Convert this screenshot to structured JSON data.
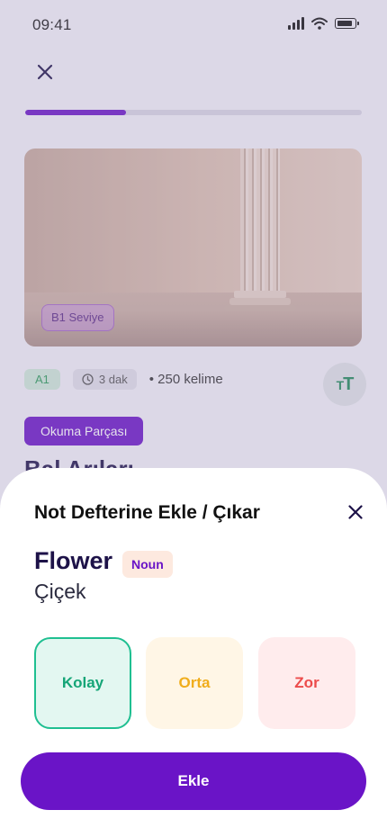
{
  "status": {
    "time": "09:41"
  },
  "lesson": {
    "progress_fraction": 0.3,
    "level_badge": "B1 Seviye",
    "level_pill": "A1",
    "duration": "3 dak",
    "words": "• 250 kelime",
    "font_size_icon": "TT",
    "section_label": "Okuma Parçası",
    "title": "Bal Arıları"
  },
  "sheet": {
    "title": "Not Defterine Ekle / Çıkar",
    "word": "Flower",
    "part_of_speech": "Noun",
    "meaning": "Çiçek",
    "difficulties": [
      "Kolay",
      "Orta",
      "Zor"
    ],
    "add_label": "Ekle"
  },
  "colors": {
    "accent": "#6a14c7",
    "easy": "#15a577",
    "medium": "#f0ad1c",
    "hard": "#ec4b4b"
  },
  "icons": [
    "signal-icon",
    "wifi-icon",
    "battery-icon",
    "close-icon",
    "clock-icon",
    "font-size-icon"
  ]
}
